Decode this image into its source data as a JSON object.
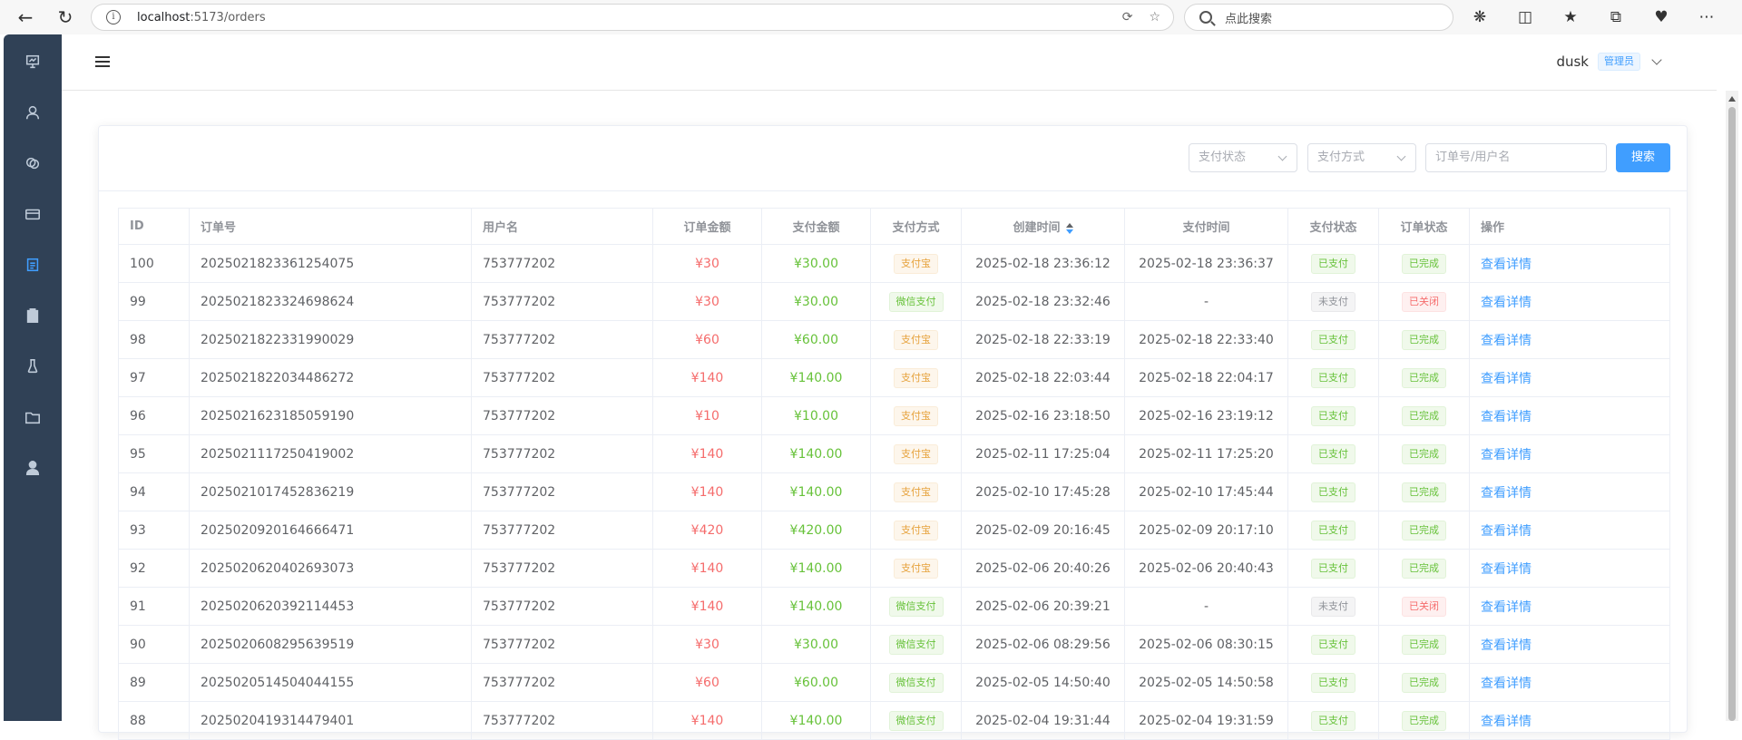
{
  "browser": {
    "url_host": "localhost",
    "url_path": ":5173/orders",
    "search_placeholder": "点此搜索"
  },
  "header": {
    "username": "dusk",
    "role": "管理员"
  },
  "filters": {
    "pay_status_placeholder": "支付状态",
    "pay_method_placeholder": "支付方式",
    "keyword_placeholder": "订单号/用户名",
    "search_label": "搜索"
  },
  "table": {
    "headers": {
      "id": "ID",
      "order_no": "订单号",
      "username": "用户名",
      "order_amount": "订单金额",
      "pay_amount": "支付金额",
      "pay_method": "支付方式",
      "created_at": "创建时间",
      "paid_at": "支付时间",
      "pay_status": "支付状态",
      "order_status": "订单状态",
      "actions": "操作"
    },
    "rows": [
      {
        "id": "100",
        "order_no": "2025021823361254075",
        "username": "753777202",
        "order_amount": "¥30",
        "pay_amount": "¥30.00",
        "pay_method": "支付宝",
        "pay_method_type": "warning",
        "created_at": "2025-02-18 23:36:12",
        "paid_at": "2025-02-18 23:36:37",
        "pay_status": "已支付",
        "pay_status_type": "success",
        "order_status": "已完成",
        "order_status_type": "success",
        "action": "查看详情"
      },
      {
        "id": "99",
        "order_no": "2025021823324698624",
        "username": "753777202",
        "order_amount": "¥30",
        "pay_amount": "¥30.00",
        "pay_method": "微信支付",
        "pay_method_type": "success",
        "created_at": "2025-02-18 23:32:46",
        "paid_at": "-",
        "pay_status": "未支付",
        "pay_status_type": "info",
        "order_status": "已关闭",
        "order_status_type": "danger",
        "action": "查看详情"
      },
      {
        "id": "98",
        "order_no": "2025021822331990029",
        "username": "753777202",
        "order_amount": "¥60",
        "pay_amount": "¥60.00",
        "pay_method": "支付宝",
        "pay_method_type": "warning",
        "created_at": "2025-02-18 22:33:19",
        "paid_at": "2025-02-18 22:33:40",
        "pay_status": "已支付",
        "pay_status_type": "success",
        "order_status": "已完成",
        "order_status_type": "success",
        "action": "查看详情"
      },
      {
        "id": "97",
        "order_no": "2025021822034486272",
        "username": "753777202",
        "order_amount": "¥140",
        "pay_amount": "¥140.00",
        "pay_method": "支付宝",
        "pay_method_type": "warning",
        "created_at": "2025-02-18 22:03:44",
        "paid_at": "2025-02-18 22:04:17",
        "pay_status": "已支付",
        "pay_status_type": "success",
        "order_status": "已完成",
        "order_status_type": "success",
        "action": "查看详情"
      },
      {
        "id": "96",
        "order_no": "2025021623185059190",
        "username": "753777202",
        "order_amount": "¥10",
        "pay_amount": "¥10.00",
        "pay_method": "支付宝",
        "pay_method_type": "warning",
        "created_at": "2025-02-16 23:18:50",
        "paid_at": "2025-02-16 23:19:12",
        "pay_status": "已支付",
        "pay_status_type": "success",
        "order_status": "已完成",
        "order_status_type": "success",
        "action": "查看详情"
      },
      {
        "id": "95",
        "order_no": "2025021117250419002",
        "username": "753777202",
        "order_amount": "¥140",
        "pay_amount": "¥140.00",
        "pay_method": "支付宝",
        "pay_method_type": "warning",
        "created_at": "2025-02-11 17:25:04",
        "paid_at": "2025-02-11 17:25:20",
        "pay_status": "已支付",
        "pay_status_type": "success",
        "order_status": "已完成",
        "order_status_type": "success",
        "action": "查看详情"
      },
      {
        "id": "94",
        "order_no": "2025021017452836219",
        "username": "753777202",
        "order_amount": "¥140",
        "pay_amount": "¥140.00",
        "pay_method": "支付宝",
        "pay_method_type": "warning",
        "created_at": "2025-02-10 17:45:28",
        "paid_at": "2025-02-10 17:45:44",
        "pay_status": "已支付",
        "pay_status_type": "success",
        "order_status": "已完成",
        "order_status_type": "success",
        "action": "查看详情"
      },
      {
        "id": "93",
        "order_no": "2025020920164666471",
        "username": "753777202",
        "order_amount": "¥420",
        "pay_amount": "¥420.00",
        "pay_method": "支付宝",
        "pay_method_type": "warning",
        "created_at": "2025-02-09 20:16:45",
        "paid_at": "2025-02-09 20:17:10",
        "pay_status": "已支付",
        "pay_status_type": "success",
        "order_status": "已完成",
        "order_status_type": "success",
        "action": "查看详情"
      },
      {
        "id": "92",
        "order_no": "2025020620402693073",
        "username": "753777202",
        "order_amount": "¥140",
        "pay_amount": "¥140.00",
        "pay_method": "支付宝",
        "pay_method_type": "warning",
        "created_at": "2025-02-06 20:40:26",
        "paid_at": "2025-02-06 20:40:43",
        "pay_status": "已支付",
        "pay_status_type": "success",
        "order_status": "已完成",
        "order_status_type": "success",
        "action": "查看详情"
      },
      {
        "id": "91",
        "order_no": "2025020620392114453",
        "username": "753777202",
        "order_amount": "¥140",
        "pay_amount": "¥140.00",
        "pay_method": "微信支付",
        "pay_method_type": "success",
        "created_at": "2025-02-06 20:39:21",
        "paid_at": "-",
        "pay_status": "未支付",
        "pay_status_type": "info",
        "order_status": "已关闭",
        "order_status_type": "danger",
        "action": "查看详情"
      },
      {
        "id": "90",
        "order_no": "2025020608295639519",
        "username": "753777202",
        "order_amount": "¥30",
        "pay_amount": "¥30.00",
        "pay_method": "微信支付",
        "pay_method_type": "success",
        "created_at": "2025-02-06 08:29:56",
        "paid_at": "2025-02-06 08:30:15",
        "pay_status": "已支付",
        "pay_status_type": "success",
        "order_status": "已完成",
        "order_status_type": "success",
        "action": "查看详情"
      },
      {
        "id": "89",
        "order_no": "2025020514504044155",
        "username": "753777202",
        "order_amount": "¥60",
        "pay_amount": "¥60.00",
        "pay_method": "微信支付",
        "pay_method_type": "success",
        "created_at": "2025-02-05 14:50:40",
        "paid_at": "2025-02-05 14:50:58",
        "pay_status": "已支付",
        "pay_status_type": "success",
        "order_status": "已完成",
        "order_status_type": "success",
        "action": "查看详情"
      },
      {
        "id": "88",
        "order_no": "2025020419314479401",
        "username": "753777202",
        "order_amount": "¥140",
        "pay_amount": "¥140.00",
        "pay_method": "微信支付",
        "pay_method_type": "success",
        "created_at": "2025-02-04 19:31:44",
        "paid_at": "2025-02-04 19:31:59",
        "pay_status": "已支付",
        "pay_status_type": "success",
        "order_status": "已完成",
        "order_status_type": "success",
        "action": "查看详情"
      }
    ]
  }
}
